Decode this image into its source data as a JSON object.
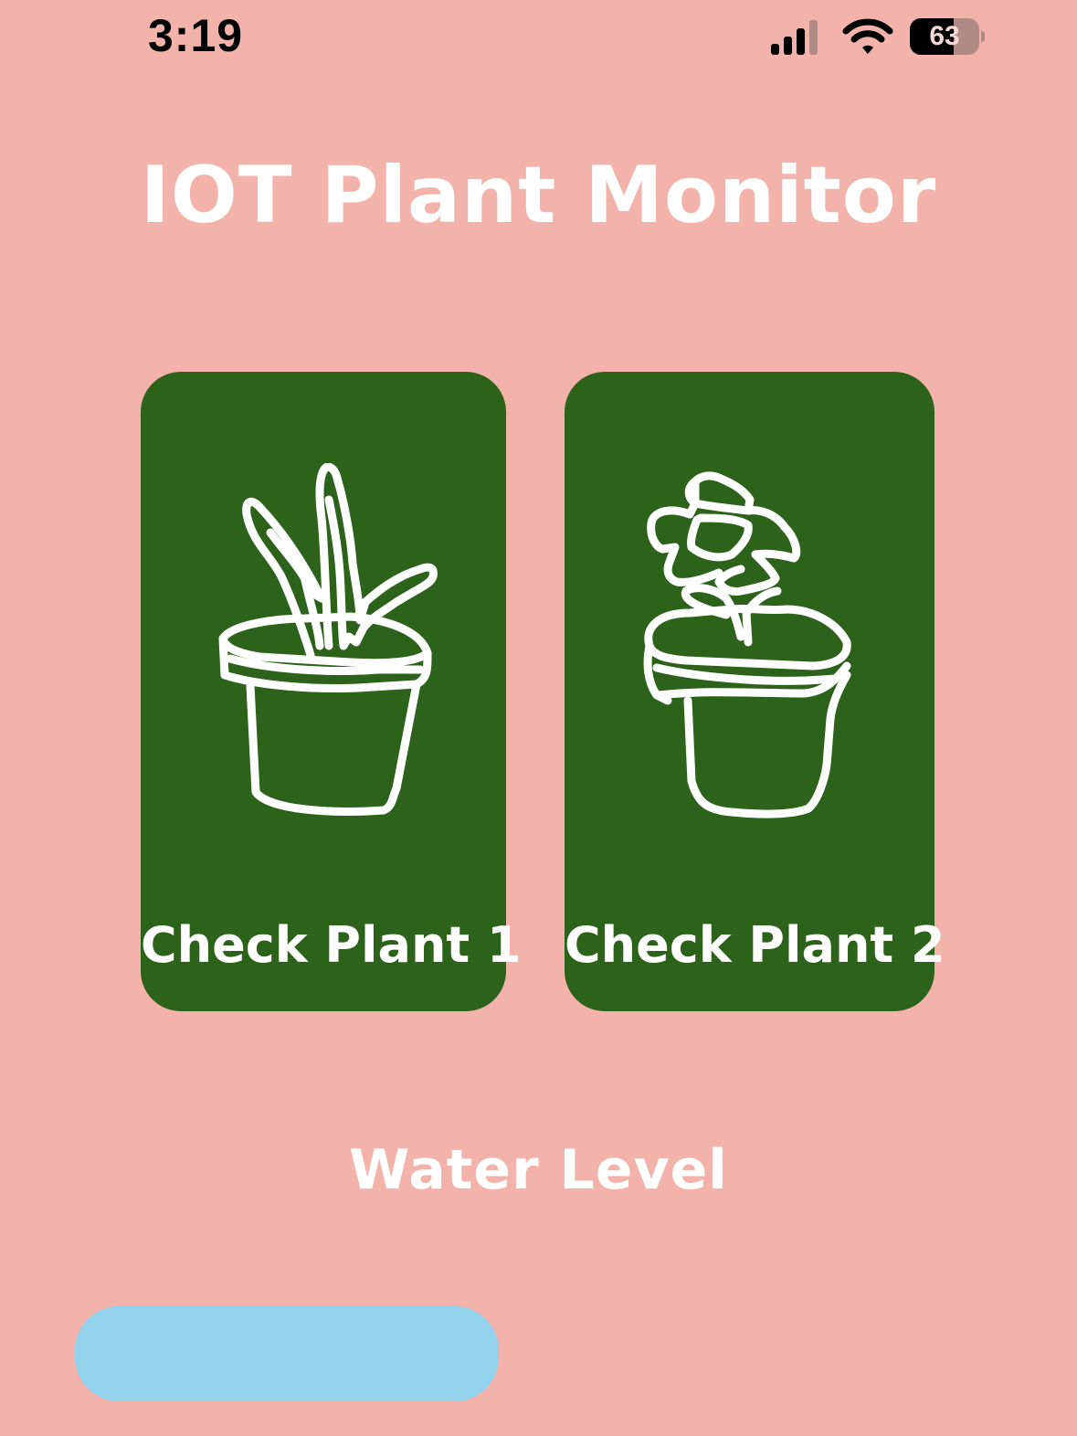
{
  "status_bar": {
    "time": "3:19",
    "battery_percent": "63",
    "battery_level": 0.63,
    "signal_bars_active": 3,
    "signal_bars_total": 4,
    "icons": [
      "signal-icon",
      "wifi-icon",
      "battery-icon"
    ]
  },
  "header": {
    "title": "IOT Plant Monitor"
  },
  "plants": [
    {
      "label": "Check Plant 1",
      "icon": "potted-plant-icon"
    },
    {
      "label": "Check Plant 2",
      "icon": "potted-flower-icon"
    }
  ],
  "water": {
    "title": "Water Level",
    "color": "#94d3ee"
  },
  "colors": {
    "background": "#f3b3ab",
    "card": "#2d621b",
    "text": "#ffffff"
  }
}
